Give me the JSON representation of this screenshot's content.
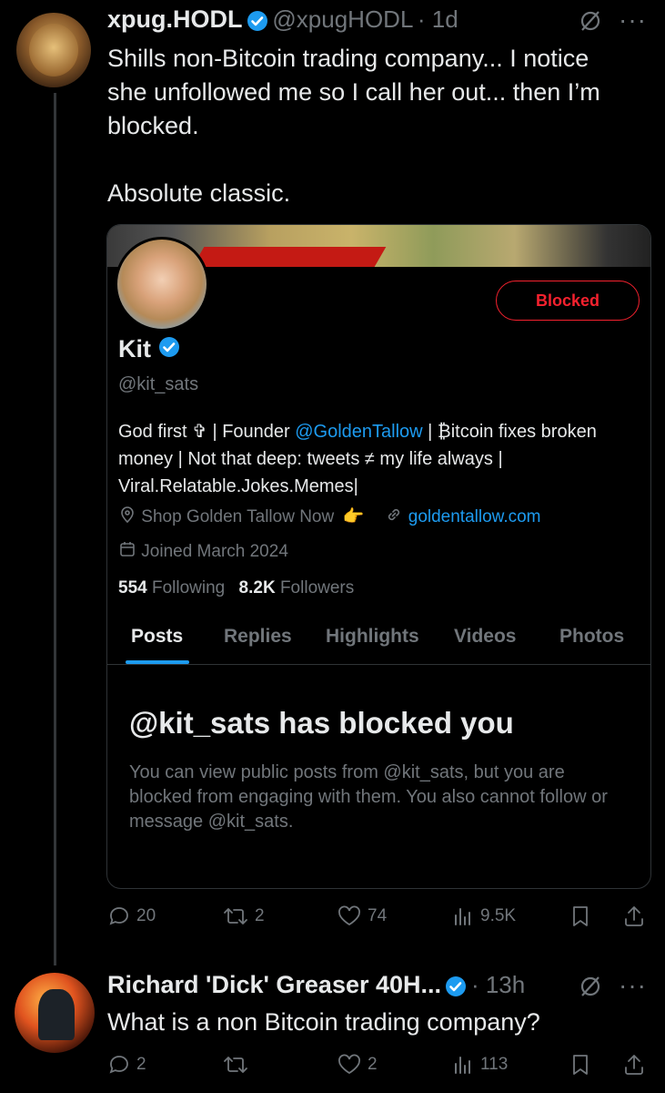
{
  "tweet1": {
    "author_name": "xpug.HODL",
    "author_handle": "@xpugHODL",
    "time": "· 1d",
    "more": "···",
    "text_lines": [
      "Shills non-Bitcoin trading company... I notice",
      "she unfollowed me so I call her out... then I’m",
      "blocked.",
      "",
      "Absolute classic."
    ],
    "actions": {
      "replies": "20",
      "reposts": "2",
      "likes": "74",
      "views": "9.5K"
    }
  },
  "profile_card": {
    "blocked_label": "Blocked",
    "name": "Kit",
    "handle": "@kit_sats",
    "bio_part1": "God first ✞ | Founder ",
    "bio_mention": "@GoldenTallow",
    "bio_part2": " | ₿itcoin fixes broken money | Not that deep: tweets ≠ my life always | Viral.Relatable.Jokes.Memes|",
    "location": "Shop Golden Tallow Now",
    "location_emoji": "👉",
    "website": "goldentallow.com",
    "joined": "Joined March 2024",
    "following_count": "554",
    "following_label": "Following",
    "followers_count": "8.2K",
    "followers_label": "Followers",
    "tabs": [
      "Posts",
      "Replies",
      "Highlights",
      "Videos",
      "Photos"
    ],
    "blocked_title": "@kit_sats has blocked you",
    "blocked_desc": "You can view public posts from @kit_sats, but you are blocked from engaging with them. You also cannot follow or message @kit_sats."
  },
  "tweet2": {
    "author_name": "Richard 'Dick' Greaser 40H...",
    "time": "· 13h",
    "more": "···",
    "text": "What is a non Bitcoin trading company?",
    "actions": {
      "replies": "2",
      "reposts": "",
      "likes": "2",
      "views": "113"
    }
  },
  "colors": {
    "accent": "#1d9bf0",
    "blocked_red": "#f4212e",
    "muted": "#71767b"
  }
}
